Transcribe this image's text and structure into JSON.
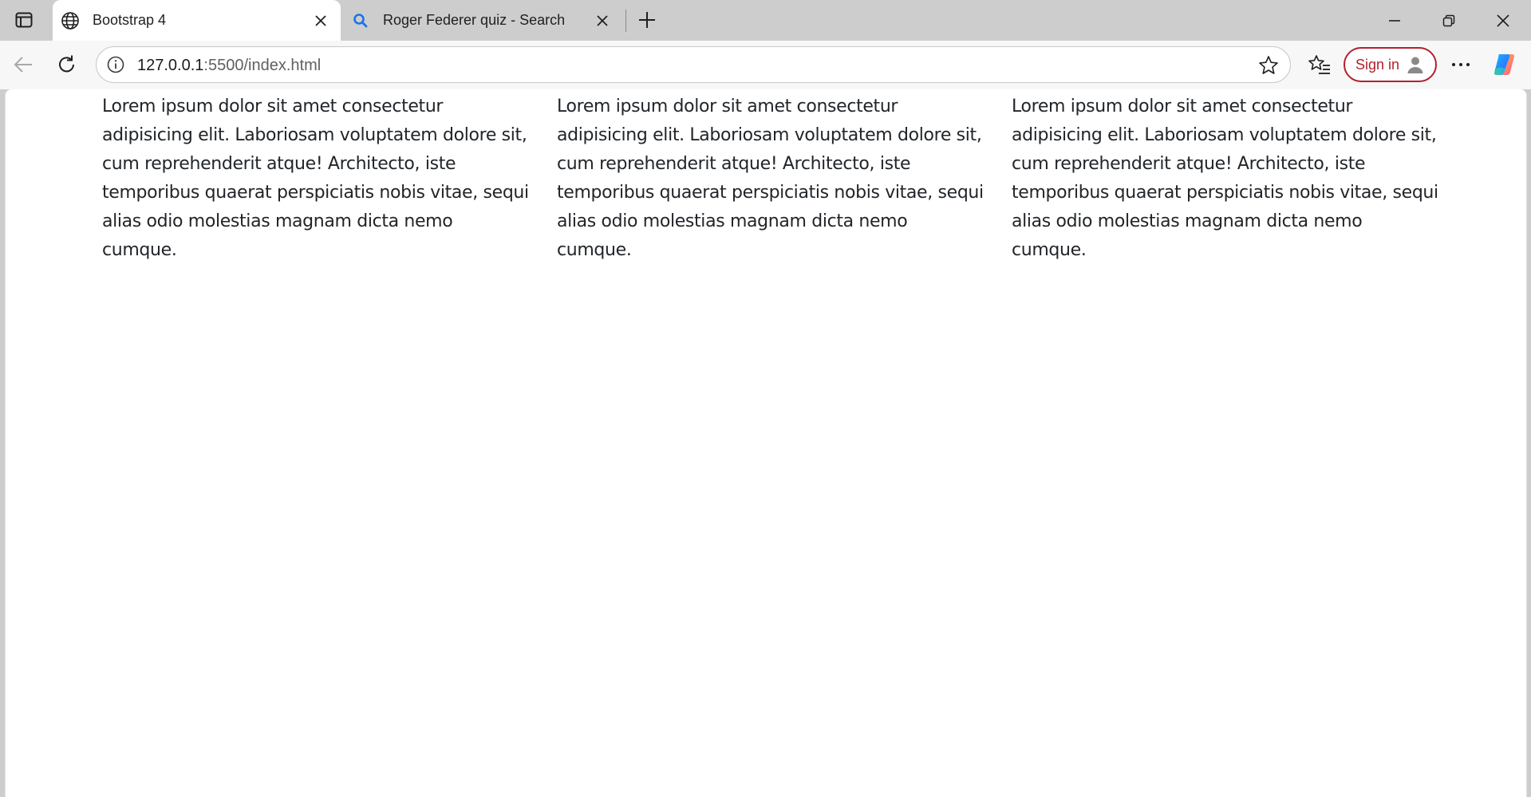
{
  "browser": {
    "tabs": [
      {
        "title": "Bootstrap 4",
        "favicon": "globe-icon",
        "active": true
      },
      {
        "title": "Roger Federer quiz - Search",
        "favicon": "search-icon",
        "active": false
      }
    ],
    "address": {
      "host": "127.0.0.1",
      "rest": ":5500/index.html"
    },
    "signin_label": "Sign in",
    "colors": {
      "tabstrip": "#cdcdcd",
      "toolbar": "#f7f7f7",
      "signin_accent": "#b21f2d",
      "search_favicon": "#1a73e8"
    }
  },
  "page": {
    "columns": [
      {
        "text": "Lorem ipsum dolor sit amet consectetur adipisicing elit. Laboriosam voluptatem dolore sit, cum reprehenderit atque! Architecto, iste temporibus quaerat perspiciatis nobis vitae, sequi alias odio molestias magnam dicta nemo cumque."
      },
      {
        "text": "Lorem ipsum dolor sit amet consectetur adipisicing elit. Laboriosam voluptatem dolore sit, cum reprehenderit atque! Architecto, iste temporibus quaerat perspiciatis nobis vitae, sequi alias odio molestias magnam dicta nemo cumque."
      },
      {
        "text": "Lorem ipsum dolor sit amet consectetur adipisicing elit. Laboriosam voluptatem dolore sit, cum reprehenderit atque! Architecto, iste temporibus quaerat perspiciatis nobis vitae, sequi alias odio molestias magnam dicta nemo cumque."
      }
    ]
  }
}
